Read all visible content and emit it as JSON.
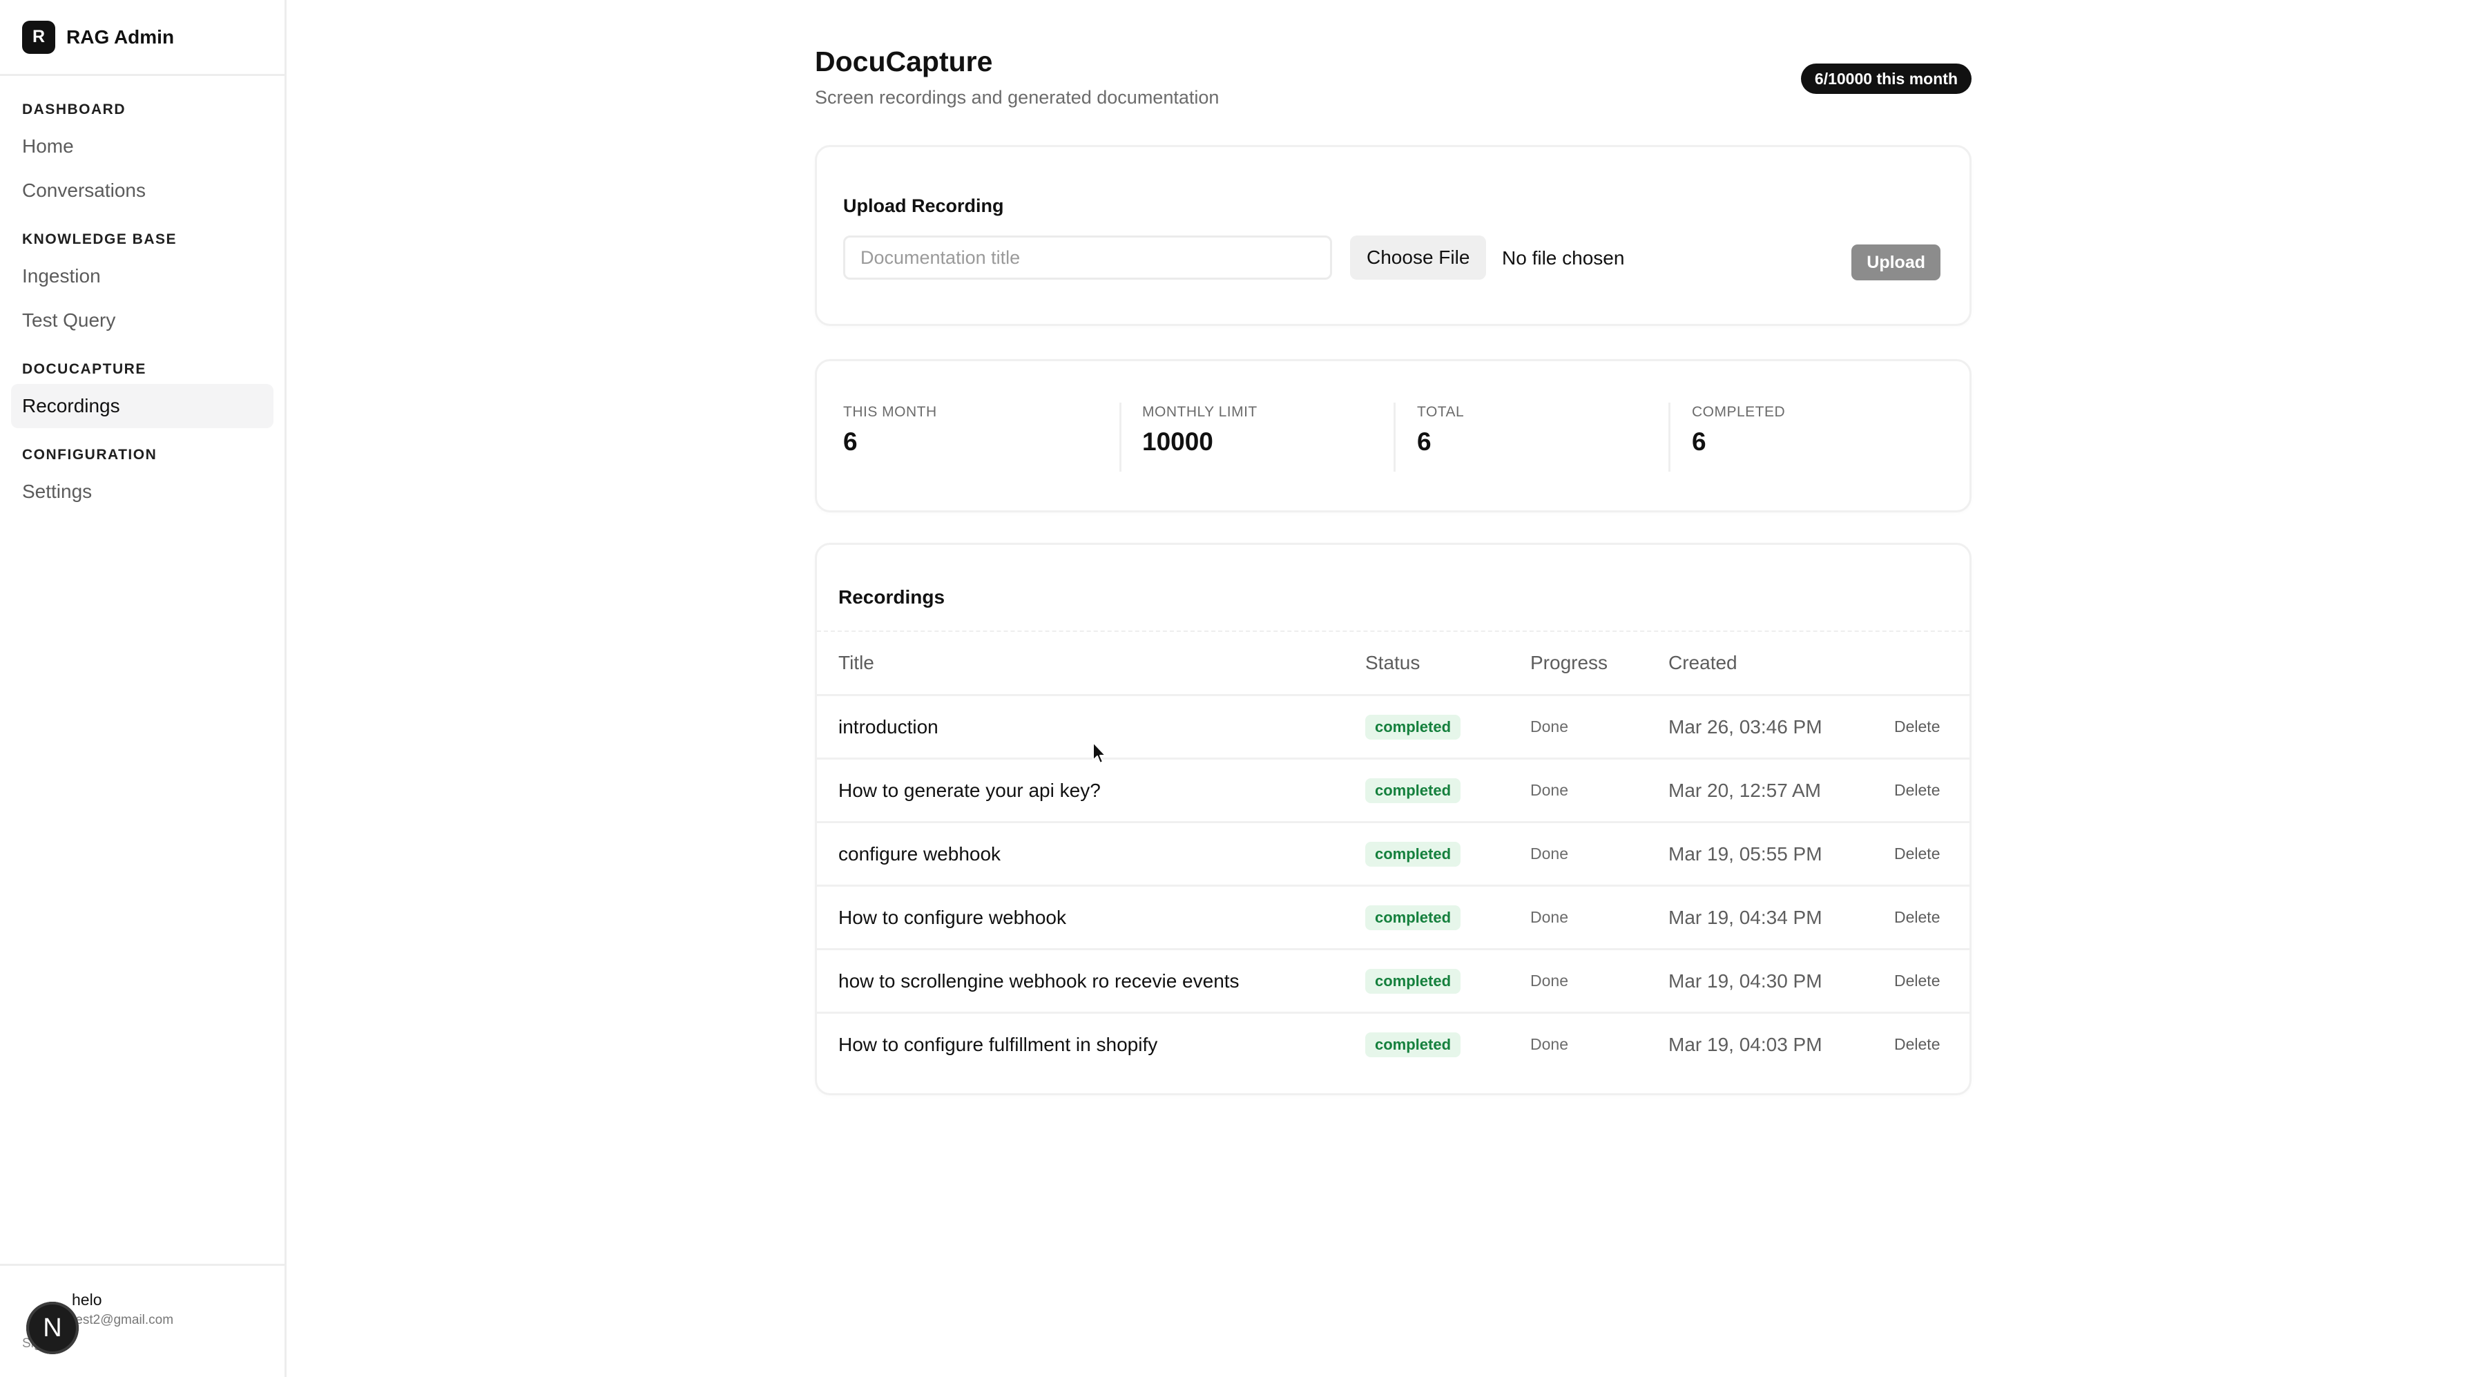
{
  "app": {
    "logo_letter": "R",
    "name": "RAG Admin"
  },
  "sidebar": {
    "sections": [
      {
        "title": "DASHBOARD",
        "items": [
          {
            "label": "Home"
          },
          {
            "label": "Conversations"
          }
        ]
      },
      {
        "title": "KNOWLEDGE BASE",
        "items": [
          {
            "label": "Ingestion"
          },
          {
            "label": "Test Query"
          }
        ]
      },
      {
        "title": "DOCUCAPTURE",
        "items": [
          {
            "label": "Recordings",
            "active": true
          }
        ]
      },
      {
        "title": "CONFIGURATION",
        "items": [
          {
            "label": "Settings"
          }
        ]
      }
    ]
  },
  "user": {
    "avatar_letter": "N",
    "name": "helo",
    "email": "test2@gmail.com",
    "signout_label": "Sign out"
  },
  "page": {
    "title": "DocuCapture",
    "subtitle": "Screen recordings and generated documentation",
    "usage_badge": "6/10000 this month"
  },
  "upload": {
    "heading": "Upload Recording",
    "title_placeholder": "Documentation title",
    "title_value": "",
    "choose_file_label": "Choose File",
    "no_file_text": "No file chosen",
    "upload_label": "Upload"
  },
  "stats": [
    {
      "label": "THIS MONTH",
      "value": "6"
    },
    {
      "label": "MONTHLY LIMIT",
      "value": "10000"
    },
    {
      "label": "TOTAL",
      "value": "6"
    },
    {
      "label": "COMPLETED",
      "value": "6"
    }
  ],
  "recordings": {
    "heading": "Recordings",
    "columns": {
      "title": "Title",
      "status": "Status",
      "progress": "Progress",
      "created": "Created"
    },
    "delete_label": "Delete",
    "rows": [
      {
        "title": "introduction",
        "status": "completed",
        "progress": "Done",
        "created": "Mar 26, 03:46 PM"
      },
      {
        "title": "How to generate your api key?",
        "status": "completed",
        "progress": "Done",
        "created": "Mar 20, 12:57 AM"
      },
      {
        "title": "configure webhook",
        "status": "completed",
        "progress": "Done",
        "created": "Mar 19, 05:55 PM"
      },
      {
        "title": "How to configure webhook",
        "status": "completed",
        "progress": "Done",
        "created": "Mar 19, 04:34 PM"
      },
      {
        "title": "how to scrollengine webhook ro recevie events",
        "status": "completed",
        "progress": "Done",
        "created": "Mar 19, 04:30 PM"
      },
      {
        "title": "How to configure fulfillment in shopify",
        "status": "completed",
        "progress": "Done",
        "created": "Mar 19, 04:03 PM"
      }
    ]
  },
  "colors": {
    "accent": "#111111",
    "status_completed_bg": "#e6f6ea",
    "status_completed_text": "#15803d",
    "upload_button": "#8c8c8c"
  }
}
